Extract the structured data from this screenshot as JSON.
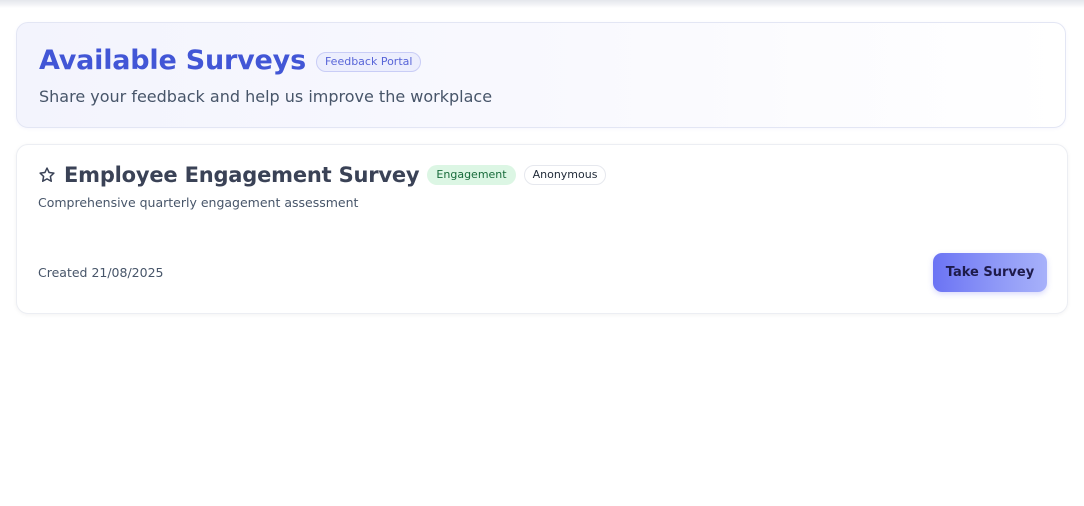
{
  "header": {
    "title": "Available Surveys",
    "badge": "Feedback Portal",
    "subtitle": "Share your feedback and help us improve the workplace"
  },
  "survey": {
    "icon": "star-outline-icon",
    "title": "Employee Engagement Survey",
    "tags": [
      "Engagement",
      "Anonymous"
    ],
    "description": "Comprehensive quarterly engagement assessment",
    "created": "Created 21/08/2025",
    "action_label": "Take Survey"
  },
  "colors": {
    "title_accent": "#4256d6",
    "engagement_tag_bg": "#dcf6e4",
    "engagement_tag_text": "#176b3a",
    "button_gradient_start": "#6b73f4",
    "button_gradient_end": "#a7b1fa"
  }
}
